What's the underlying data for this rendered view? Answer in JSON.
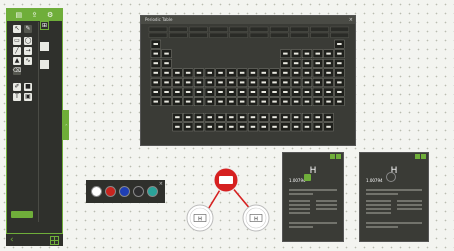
{
  "toolbar": {
    "section_a_title": "",
    "section_b_title": "",
    "section_c_title": "",
    "action_label": ""
  },
  "bottom_nav": {
    "page_text": ""
  },
  "periodic_table": {
    "title": "Periodic Table"
  },
  "color_picker": {
    "colors": [
      "#ffffff",
      "#c8241e",
      "#1f3fb5",
      "#2e2e30",
      "#2aa39a"
    ]
  },
  "molecule": {
    "center_atom": "",
    "left_atom": "H",
    "right_atom": "H",
    "accent_color": "#d62020"
  },
  "cards": [
    {
      "symbol": "H",
      "mass": "1.00794",
      "badge": ""
    },
    {
      "symbol": "H",
      "mass": "1.00794",
      "badge": ""
    }
  ],
  "colors": {
    "accent": "#6fae3a",
    "panel": "#2f302c"
  }
}
